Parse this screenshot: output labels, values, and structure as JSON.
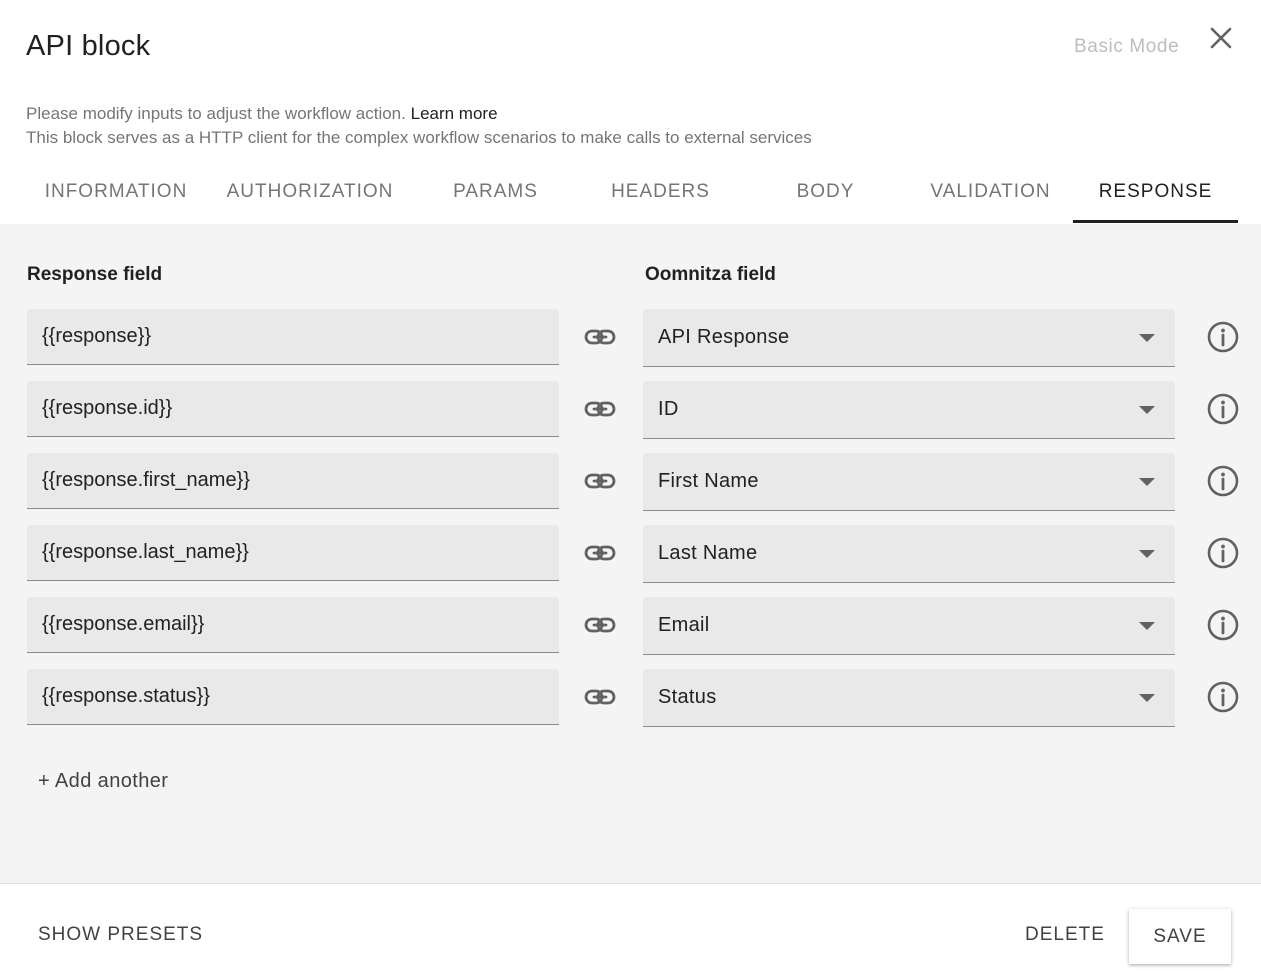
{
  "header": {
    "title": "API block",
    "mode_toggle": "Basic Mode",
    "close_icon": "close-icon",
    "description_line1": "Please modify inputs to adjust the workflow action.",
    "learn_more": "Learn more",
    "description_line2": "This block serves as a HTTP client for the complex workflow scenarios to make calls to external services"
  },
  "tabs": [
    {
      "label": "INFORMATION",
      "active": false
    },
    {
      "label": "AUTHORIZATION",
      "active": false
    },
    {
      "label": "PARAMS",
      "active": false
    },
    {
      "label": "HEADERS",
      "active": false
    },
    {
      "label": "BODY",
      "active": false
    },
    {
      "label": "VALIDATION",
      "active": false
    },
    {
      "label": "RESPONSE",
      "active": true
    }
  ],
  "response_tab": {
    "response_field_label": "Response field",
    "oomnitza_field_label": "Oomnitza field",
    "mappings": [
      {
        "response": "{{response}}",
        "field": "API Response"
      },
      {
        "response": "{{response.id}}",
        "field": "ID"
      },
      {
        "response": "{{response.first_name}}",
        "field": "First Name"
      },
      {
        "response": "{{response.last_name}}",
        "field": "Last Name"
      },
      {
        "response": "{{response.email}}",
        "field": "Email"
      },
      {
        "response": "{{response.status}}",
        "field": "Status"
      }
    ],
    "add_another": "+ Add another",
    "icons": {
      "link": "link-icon",
      "info": "info-icon",
      "dropdown": "chevron-down-icon"
    }
  },
  "footer": {
    "show_presets": "SHOW PRESETS",
    "delete": "DELETE",
    "save": "SAVE"
  }
}
